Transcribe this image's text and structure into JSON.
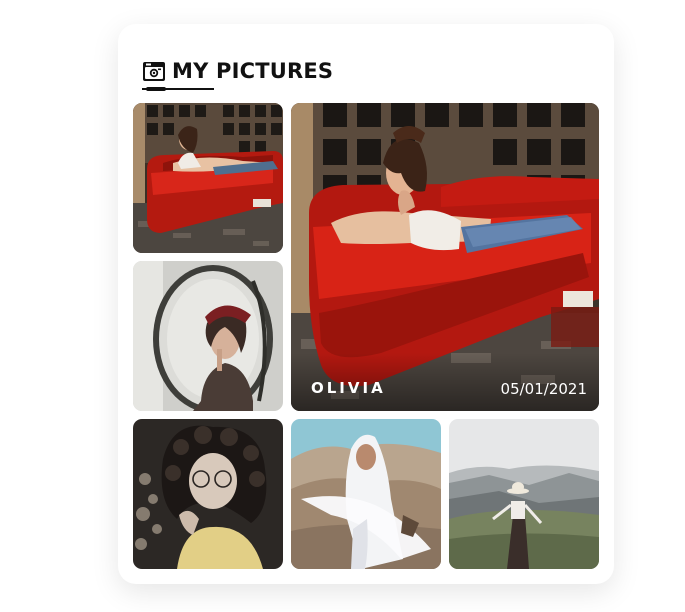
{
  "header": {
    "title": "MY PICTURES",
    "icon": "camera-icon"
  },
  "featured": {
    "name": "OLIVIA",
    "date": "05/01/2021"
  },
  "colors": {
    "title": "#111111",
    "card": "#ffffff",
    "sofa_red": "#c41a12",
    "caption": "#ffffff"
  }
}
